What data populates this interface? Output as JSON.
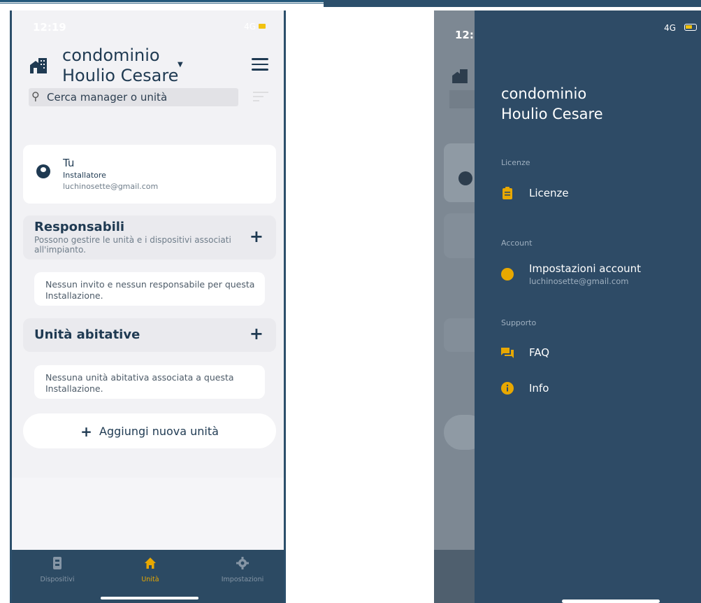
{
  "status": {
    "time": "12:19",
    "network": "4G"
  },
  "header": {
    "title_line1": "condominio",
    "title_line2": "Houlio Cesare",
    "search_placeholder": "Cerca manager o unità"
  },
  "user_card": {
    "name": "Tu",
    "role": "Installatore",
    "email": "luchinosette@gmail.com"
  },
  "responsabili": {
    "title": "Responsabili",
    "subtitle": "Possono gestire le unità e i dispositivi associati all'impianto.",
    "empty_note": "Nessun invito e nessun responsabile per questa Installazione."
  },
  "unita": {
    "title": "Unità abitative",
    "empty_note": "Nessuna unità abitativa associata a questa Installazione.",
    "add_button": "Aggiungi nuova unità"
  },
  "tabbar": {
    "items": [
      {
        "label": "Dispositivi",
        "icon": "device-icon",
        "active": false
      },
      {
        "label": "Unità",
        "icon": "home-icon",
        "active": true
      },
      {
        "label": "Impostazioni",
        "icon": "gear-icon",
        "active": false
      }
    ]
  },
  "drawer": {
    "title_line1": "condominio",
    "title_line2": "Houlio Cesare",
    "sections": {
      "licenze_header": "Licenze",
      "licenze_item": "Licenze",
      "account_header": "Account",
      "account_item": "Impostazioni account",
      "account_email": "luchinosette@gmail.com",
      "supporto_header": "Supporto",
      "faq_item": "FAQ",
      "info_item": "Info"
    }
  },
  "colors": {
    "primary_dark": "#1f3a52",
    "drawer_bg": "#2e4b66",
    "accent": "#e8a800",
    "tabbar_bg": "#2c4a63"
  }
}
